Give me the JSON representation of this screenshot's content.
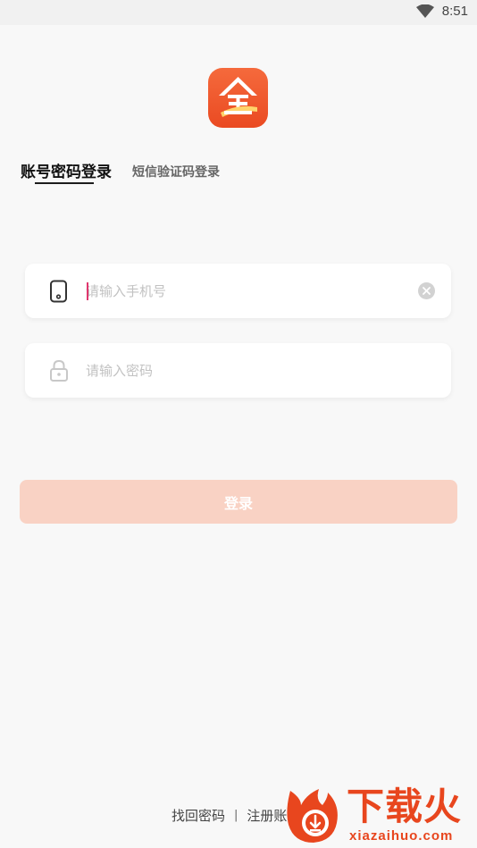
{
  "status_bar": {
    "time": "8:51"
  },
  "tabs": {
    "account": "账号密码登录",
    "sms": "短信验证码登录"
  },
  "phone_field": {
    "placeholder": "请输入手机号",
    "value": ""
  },
  "password_field": {
    "placeholder": "请输入密码",
    "value": ""
  },
  "login_button": {
    "label": "登录"
  },
  "footer": {
    "forgot": "找回密码",
    "separator": "|",
    "register": "注册账号"
  },
  "watermark": {
    "brand": "下载火",
    "domain": "xiazaihuo.com"
  },
  "colors": {
    "accent": "#ea4a22",
    "login_button_bg": "#f9d2c4",
    "caret": "#e0366e",
    "watermark": "#e8461e"
  }
}
